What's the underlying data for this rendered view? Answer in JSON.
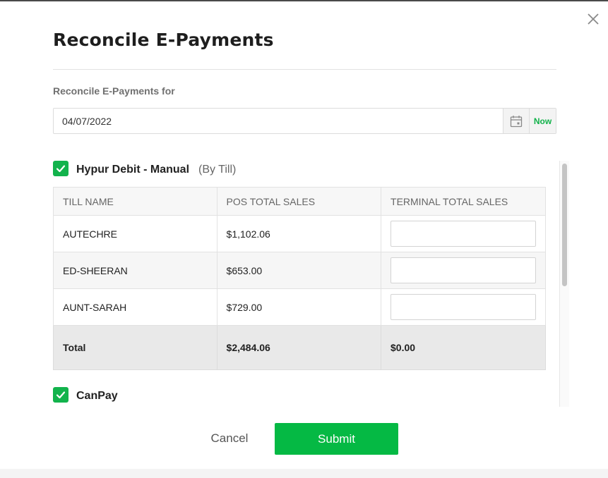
{
  "dialog": {
    "title": "Reconcile E-Payments",
    "close_icon": "close-icon"
  },
  "date_picker": {
    "label": "Reconcile E-Payments for",
    "value": "04/07/2022",
    "calendar_icon": "calendar-icon",
    "now_label": "Now"
  },
  "sections": [
    {
      "checked": true,
      "title": "Hypur Debit - Manual",
      "subtitle": "(By Till)",
      "columns": [
        "TILL NAME",
        "POS TOTAL SALES",
        "TERMINAL TOTAL SALES"
      ],
      "rows": [
        {
          "till_name": "AUTECHRE",
          "pos_total": "$1,102.06",
          "terminal_total": ""
        },
        {
          "till_name": "ED-SHEERAN",
          "pos_total": "$653.00",
          "terminal_total": ""
        },
        {
          "till_name": "AUNT-SARAH",
          "pos_total": "$729.00",
          "terminal_total": ""
        }
      ],
      "total": {
        "label": "Total",
        "pos_total": "$2,484.06",
        "terminal_total": "$0.00"
      }
    },
    {
      "checked": true,
      "title": "CanPay"
    }
  ],
  "footer": {
    "cancel_label": "Cancel",
    "submit_label": "Submit"
  },
  "colors": {
    "accent_green": "#05b944",
    "checkbox_green": "#12b34c"
  }
}
